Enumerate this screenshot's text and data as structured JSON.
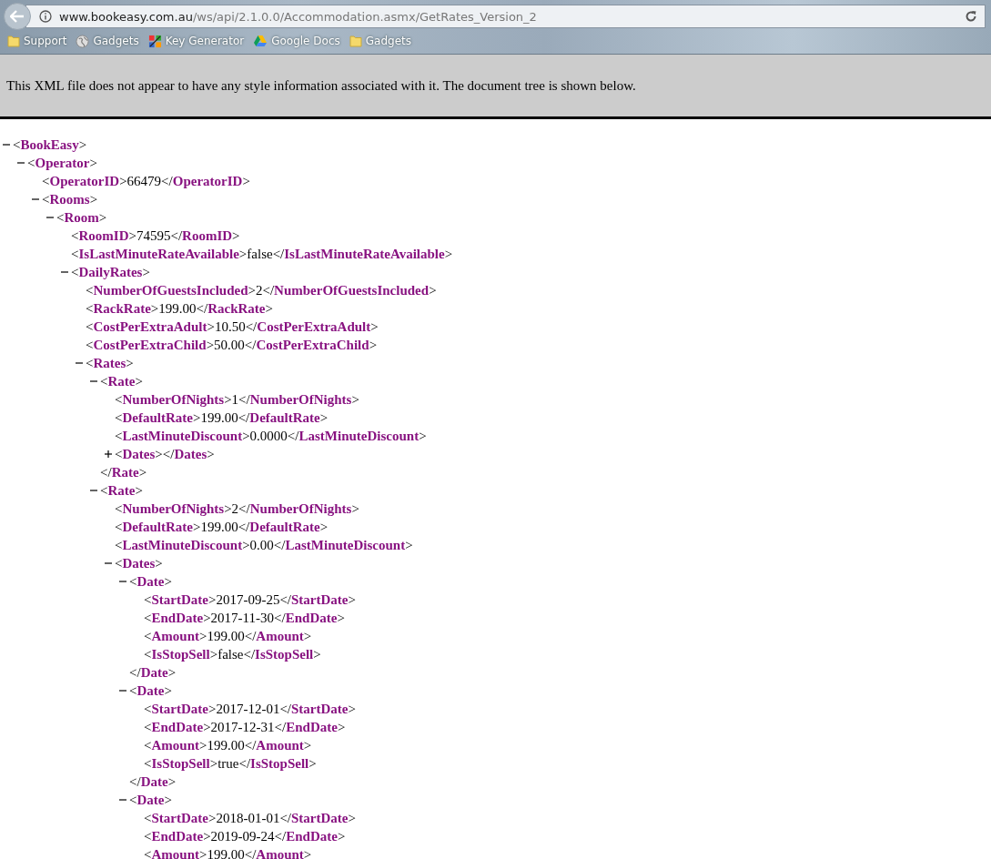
{
  "browser": {
    "url": {
      "host": "www.bookeasy.com.au",
      "path": "/ws/api/2.1.0.0/Accommodation.asmx/GetRates_Version_2"
    },
    "bookmarks": [
      {
        "kind": "folder",
        "label": "Support"
      },
      {
        "kind": "globe",
        "label": "Gadgets"
      },
      {
        "kind": "tool",
        "label": "Key Generator"
      },
      {
        "kind": "drive",
        "label": "Google Docs"
      },
      {
        "kind": "folder",
        "label": "Gadgets"
      }
    ]
  },
  "notice": "This XML file does not appear to have any style information associated with it. The document tree is shown below.",
  "document": [
    {
      "open": "<**BookEasy**>",
      "expanded": true,
      "children": [
        {
          "open": "<**Operator**>",
          "expanded": true,
          "children": [
            {
              "line": "<**OperatorID**>66479</**OperatorID**>"
            },
            {
              "open": "<**Rooms**>",
              "expanded": true,
              "children": [
                {
                  "open": "<**Room**>",
                  "expanded": true,
                  "children": [
                    {
                      "line": "<**RoomID**>74595</**RoomID**>"
                    },
                    {
                      "line": "<**IsLastMinuteRateAvailable**>false</**IsLastMinuteRateAvailable**>"
                    },
                    {
                      "open": "<**DailyRates**>",
                      "expanded": true,
                      "children": [
                        {
                          "line": "<**NumberOfGuestsIncluded**>2</**NumberOfGuestsIncluded**>"
                        },
                        {
                          "line": "<**RackRate**>199.00</**RackRate**>"
                        },
                        {
                          "line": "<**CostPerExtraAdult**>10.50</**CostPerExtraAdult**>"
                        },
                        {
                          "line": "<**CostPerExtraChild**>50.00</**CostPerExtraChild**>"
                        },
                        {
                          "open": "<**Rates**>",
                          "expanded": true,
                          "children": [
                            {
                              "open": "<**Rate**>",
                              "expanded": true,
                              "close": "</**Rate**>",
                              "children": [
                                {
                                  "line": "<**NumberOfNights**>1</**NumberOfNights**>"
                                },
                                {
                                  "line": "<**DefaultRate**>199.00</**DefaultRate**>"
                                },
                                {
                                  "line": "<**LastMinuteDiscount**>0.0000</**LastMinuteDiscount**>"
                                },
                                {
                                  "open": "<**Dates**></**Dates**>",
                                  "expanded": false
                                }
                              ]
                            },
                            {
                              "open": "<**Rate**>",
                              "expanded": true,
                              "children": [
                                {
                                  "line": "<**NumberOfNights**>2</**NumberOfNights**>"
                                },
                                {
                                  "line": "<**DefaultRate**>199.00</**DefaultRate**>"
                                },
                                {
                                  "line": "<**LastMinuteDiscount**>0.00</**LastMinuteDiscount**>"
                                },
                                {
                                  "open": "<**Dates**>",
                                  "expanded": true,
                                  "children": [
                                    {
                                      "open": "<**Date**>",
                                      "expanded": true,
                                      "close": "</**Date**>",
                                      "children": [
                                        {
                                          "line": "<**StartDate**>2017-09-25</**StartDate**>"
                                        },
                                        {
                                          "line": "<**EndDate**>2017-11-30</**EndDate**>"
                                        },
                                        {
                                          "line": "<**Amount**>199.00</**Amount**>"
                                        },
                                        {
                                          "line": "<**IsStopSell**>false</**IsStopSell**>"
                                        }
                                      ]
                                    },
                                    {
                                      "open": "<**Date**>",
                                      "expanded": true,
                                      "close": "</**Date**>",
                                      "children": [
                                        {
                                          "line": "<**StartDate**>2017-12-01</**StartDate**>"
                                        },
                                        {
                                          "line": "<**EndDate**>2017-12-31</**EndDate**>"
                                        },
                                        {
                                          "line": "<**Amount**>199.00</**Amount**>"
                                        },
                                        {
                                          "line": "<**IsStopSell**>true</**IsStopSell**>"
                                        }
                                      ]
                                    },
                                    {
                                      "open": "<**Date**>",
                                      "expanded": true,
                                      "children": [
                                        {
                                          "line": "<**StartDate**>2018-01-01</**StartDate**>"
                                        },
                                        {
                                          "line": "<**EndDate**>2019-09-24</**EndDate**>"
                                        },
                                        {
                                          "line": "<**Amount**>199.00</**Amount**>"
                                        }
                                      ]
                                    }
                                  ]
                                }
                              ]
                            }
                          ]
                        }
                      ]
                    }
                  ]
                }
              ]
            }
          ]
        }
      ]
    }
  ]
}
